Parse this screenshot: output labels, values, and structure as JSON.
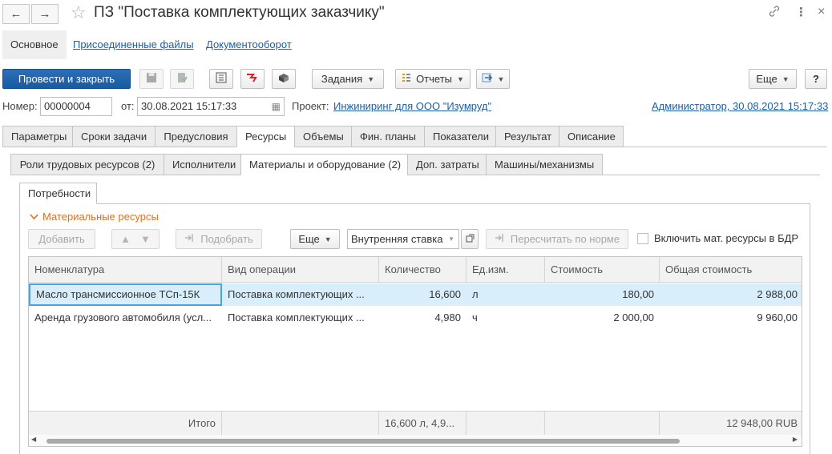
{
  "window": {
    "title": "ПЗ \"Поставка комплектующих заказчику\"",
    "back_icon": "←",
    "forward_icon": "→",
    "star_icon": "☆",
    "link_icon": "🔗",
    "menu_icon": "⋮",
    "close_icon": "×"
  },
  "sections": {
    "main": "Основное",
    "files": "Присоединенные файлы",
    "docflow": "Документооборот"
  },
  "toolbar": {
    "post_close": "Провести и закрыть",
    "tasks": "Задания",
    "reports": "Отчеты",
    "more": "Еще",
    "help": "?"
  },
  "header": {
    "number_label": "Номер:",
    "number_value": "00000004",
    "date_label": "от:",
    "date_value": "30.08.2021 15:17:33",
    "project_label": "Проект:",
    "project_value": "Инжиниринг для ООО \"Изумруд\"",
    "author": "Администратор, 30.08.2021 15:17:33"
  },
  "tabs": [
    "Параметры",
    "Сроки задачи",
    "Предусловия",
    "Ресурсы",
    "Объемы",
    "Фин. планы",
    "Показатели",
    "Результат",
    "Описание"
  ],
  "subtabs": [
    "Роли трудовых ресурсов (2)",
    "Исполнители",
    "Материалы и оборудование (2)",
    "Доп. затраты",
    "Машины/механизмы"
  ],
  "inner_tab": "Потребности",
  "group": {
    "title": "Материальные ресурсы",
    "add": "Добавить",
    "pick": "Подобрать",
    "more": "Еще",
    "rate": "Внутренняя ставка",
    "recalc": "Пересчитать по норме",
    "include": "Включить мат. ресурсы в БДР"
  },
  "table": {
    "columns": [
      "Номенклатура",
      "Вид операции",
      "Количество",
      "Ед.изм.",
      "Стоимость",
      "Общая стоимость"
    ],
    "rows": [
      {
        "name": "Масло трансмиссионное ТСп-15К",
        "op": "Поставка комплектующих ...",
        "qty": "16,600",
        "unit": "л",
        "price": "180,00",
        "total": "2 988,00"
      },
      {
        "name": "Аренда грузового автомобиля (усл...",
        "op": "Поставка комплектующих ...",
        "qty": "4,980",
        "unit": "ч",
        "price": "2 000,00",
        "total": "9 960,00"
      }
    ],
    "footer": {
      "label": "Итого",
      "qty": "16,600 л, 4,9...",
      "total": "12 948,00 RUB"
    }
  }
}
